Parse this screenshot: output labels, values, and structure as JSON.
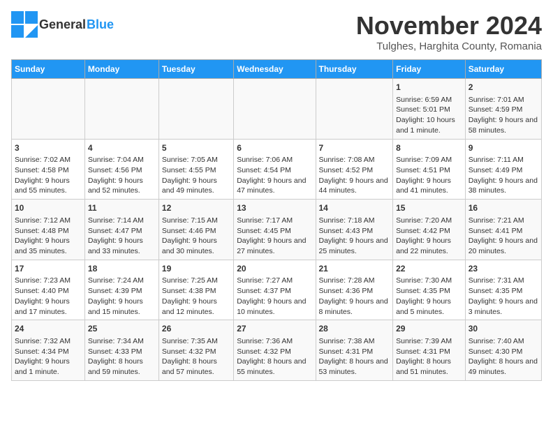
{
  "header": {
    "logo_general": "General",
    "logo_blue": "Blue",
    "title": "November 2024",
    "subtitle": "Tulghes, Harghita County, Romania"
  },
  "days_of_week": [
    "Sunday",
    "Monday",
    "Tuesday",
    "Wednesday",
    "Thursday",
    "Friday",
    "Saturday"
  ],
  "weeks": [
    [
      {
        "day": "",
        "info": ""
      },
      {
        "day": "",
        "info": ""
      },
      {
        "day": "",
        "info": ""
      },
      {
        "day": "",
        "info": ""
      },
      {
        "day": "",
        "info": ""
      },
      {
        "day": "1",
        "info": "Sunrise: 6:59 AM\nSunset: 5:01 PM\nDaylight: 10 hours and 1 minute."
      },
      {
        "day": "2",
        "info": "Sunrise: 7:01 AM\nSunset: 4:59 PM\nDaylight: 9 hours and 58 minutes."
      }
    ],
    [
      {
        "day": "3",
        "info": "Sunrise: 7:02 AM\nSunset: 4:58 PM\nDaylight: 9 hours and 55 minutes."
      },
      {
        "day": "4",
        "info": "Sunrise: 7:04 AM\nSunset: 4:56 PM\nDaylight: 9 hours and 52 minutes."
      },
      {
        "day": "5",
        "info": "Sunrise: 7:05 AM\nSunset: 4:55 PM\nDaylight: 9 hours and 49 minutes."
      },
      {
        "day": "6",
        "info": "Sunrise: 7:06 AM\nSunset: 4:54 PM\nDaylight: 9 hours and 47 minutes."
      },
      {
        "day": "7",
        "info": "Sunrise: 7:08 AM\nSunset: 4:52 PM\nDaylight: 9 hours and 44 minutes."
      },
      {
        "day": "8",
        "info": "Sunrise: 7:09 AM\nSunset: 4:51 PM\nDaylight: 9 hours and 41 minutes."
      },
      {
        "day": "9",
        "info": "Sunrise: 7:11 AM\nSunset: 4:49 PM\nDaylight: 9 hours and 38 minutes."
      }
    ],
    [
      {
        "day": "10",
        "info": "Sunrise: 7:12 AM\nSunset: 4:48 PM\nDaylight: 9 hours and 35 minutes."
      },
      {
        "day": "11",
        "info": "Sunrise: 7:14 AM\nSunset: 4:47 PM\nDaylight: 9 hours and 33 minutes."
      },
      {
        "day": "12",
        "info": "Sunrise: 7:15 AM\nSunset: 4:46 PM\nDaylight: 9 hours and 30 minutes."
      },
      {
        "day": "13",
        "info": "Sunrise: 7:17 AM\nSunset: 4:45 PM\nDaylight: 9 hours and 27 minutes."
      },
      {
        "day": "14",
        "info": "Sunrise: 7:18 AM\nSunset: 4:43 PM\nDaylight: 9 hours and 25 minutes."
      },
      {
        "day": "15",
        "info": "Sunrise: 7:20 AM\nSunset: 4:42 PM\nDaylight: 9 hours and 22 minutes."
      },
      {
        "day": "16",
        "info": "Sunrise: 7:21 AM\nSunset: 4:41 PM\nDaylight: 9 hours and 20 minutes."
      }
    ],
    [
      {
        "day": "17",
        "info": "Sunrise: 7:23 AM\nSunset: 4:40 PM\nDaylight: 9 hours and 17 minutes."
      },
      {
        "day": "18",
        "info": "Sunrise: 7:24 AM\nSunset: 4:39 PM\nDaylight: 9 hours and 15 minutes."
      },
      {
        "day": "19",
        "info": "Sunrise: 7:25 AM\nSunset: 4:38 PM\nDaylight: 9 hours and 12 minutes."
      },
      {
        "day": "20",
        "info": "Sunrise: 7:27 AM\nSunset: 4:37 PM\nDaylight: 9 hours and 10 minutes."
      },
      {
        "day": "21",
        "info": "Sunrise: 7:28 AM\nSunset: 4:36 PM\nDaylight: 9 hours and 8 minutes."
      },
      {
        "day": "22",
        "info": "Sunrise: 7:30 AM\nSunset: 4:35 PM\nDaylight: 9 hours and 5 minutes."
      },
      {
        "day": "23",
        "info": "Sunrise: 7:31 AM\nSunset: 4:35 PM\nDaylight: 9 hours and 3 minutes."
      }
    ],
    [
      {
        "day": "24",
        "info": "Sunrise: 7:32 AM\nSunset: 4:34 PM\nDaylight: 9 hours and 1 minute."
      },
      {
        "day": "25",
        "info": "Sunrise: 7:34 AM\nSunset: 4:33 PM\nDaylight: 8 hours and 59 minutes."
      },
      {
        "day": "26",
        "info": "Sunrise: 7:35 AM\nSunset: 4:32 PM\nDaylight: 8 hours and 57 minutes."
      },
      {
        "day": "27",
        "info": "Sunrise: 7:36 AM\nSunset: 4:32 PM\nDaylight: 8 hours and 55 minutes."
      },
      {
        "day": "28",
        "info": "Sunrise: 7:38 AM\nSunset: 4:31 PM\nDaylight: 8 hours and 53 minutes."
      },
      {
        "day": "29",
        "info": "Sunrise: 7:39 AM\nSunset: 4:31 PM\nDaylight: 8 hours and 51 minutes."
      },
      {
        "day": "30",
        "info": "Sunrise: 7:40 AM\nSunset: 4:30 PM\nDaylight: 8 hours and 49 minutes."
      }
    ]
  ]
}
